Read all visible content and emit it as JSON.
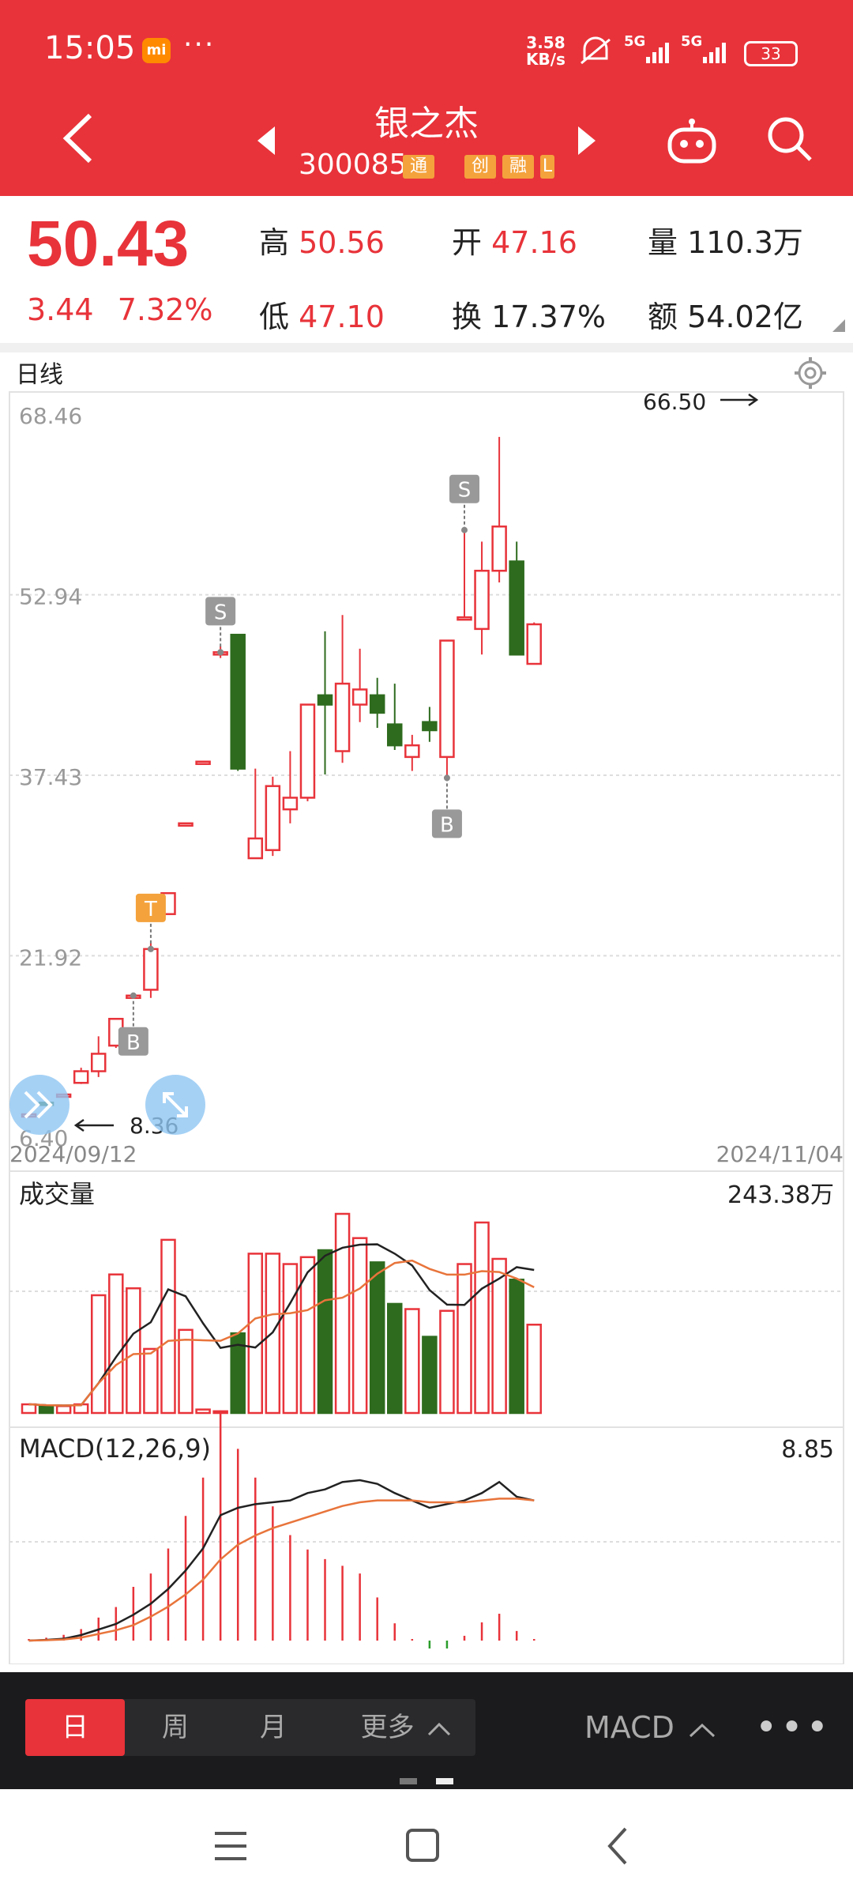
{
  "status_bar": {
    "time": "15:05",
    "mi": "mi",
    "dots": "···",
    "speed_top": "3.58",
    "speed_bottom": "KB/s",
    "sig1": "5G",
    "sig2": "5G",
    "battery": "33"
  },
  "header": {
    "name": "银之杰",
    "code": "300085",
    "tags": [
      "通",
      "创",
      "融",
      "L"
    ]
  },
  "quote": {
    "price": "50.43",
    "change": "3.44",
    "change_pct": "7.32%",
    "high_label": "高",
    "high": "50.56",
    "open_label": "开",
    "open": "47.16",
    "vol_label": "量",
    "vol": "110.3万",
    "low_label": "低",
    "low": "47.10",
    "turn_label": "换",
    "turn": "17.37%",
    "amount_label": "额",
    "amount": "54.02亿"
  },
  "kline_panel": {
    "title": "日线",
    "y_labels": [
      "68.46",
      "52.94",
      "37.43",
      "21.92",
      "6.40"
    ],
    "max_note": "66.50",
    "min_note": "8.36",
    "date_start": "2024/09/12",
    "date_end": "2024/11/04",
    "markers": [
      "S",
      "T",
      "B",
      "S",
      "B"
    ]
  },
  "volume_panel": {
    "title": "成交量",
    "max": "243.38万"
  },
  "macd_panel": {
    "title": "MACD(12,26,9)",
    "value": "8.85"
  },
  "bottom_bar": {
    "day": "日",
    "week": "周",
    "month": "月",
    "more": "更多",
    "indicator": "MACD",
    "dots": "•••"
  },
  "colors": {
    "up": "#e8333a",
    "down": "#2e6b1e",
    "ma1": "#222222",
    "ma2": "#e8743b"
  },
  "chart_data": {
    "type": "candlestick",
    "price_range": [
      6.4,
      68.46
    ],
    "candles": [
      {
        "o": 8.3,
        "c": 8.3,
        "h": 8.36,
        "l": 8.36
      },
      {
        "o": 9.3,
        "c": 9.1,
        "h": 9.4,
        "l": 9.0
      },
      {
        "o": 10.0,
        "c": 10.0,
        "h": 10.0,
        "l": 10.0
      },
      {
        "o": 11.0,
        "c": 12.0,
        "h": 12.3,
        "l": 10.9
      },
      {
        "o": 12.0,
        "c": 13.5,
        "h": 15.0,
        "l": 11.5
      },
      {
        "o": 14.2,
        "c": 16.5,
        "h": 16.5,
        "l": 14.0
      },
      {
        "o": 18.5,
        "c": 18.5,
        "h": 18.5,
        "l": 18.5
      },
      {
        "o": 19.0,
        "c": 22.5,
        "h": 23.0,
        "l": 18.3
      },
      {
        "o": 25.5,
        "c": 27.3,
        "h": 27.3,
        "l": 25.5
      },
      {
        "o": 33.3,
        "c": 33.3,
        "h": 33.3,
        "l": 33.3
      },
      {
        "o": 38.6,
        "c": 38.6,
        "h": 38.6,
        "l": 38.6
      },
      {
        "o": 48.0,
        "c": 48.0,
        "h": 48.5,
        "l": 47.5
      },
      {
        "o": 49.5,
        "c": 38.0,
        "h": 49.5,
        "l": 37.8
      },
      {
        "o": 30.3,
        "c": 32.0,
        "h": 38.0,
        "l": 30.3
      },
      {
        "o": 31.0,
        "c": 36.5,
        "h": 37.3,
        "l": 30.5
      },
      {
        "o": 34.5,
        "c": 35.5,
        "h": 39.5,
        "l": 33.3
      },
      {
        "o": 35.5,
        "c": 43.5,
        "h": 43.5,
        "l": 35.2
      },
      {
        "o": 44.3,
        "c": 43.5,
        "h": 49.8,
        "l": 37.5
      },
      {
        "o": 39.5,
        "c": 45.3,
        "h": 51.2,
        "l": 38.5
      },
      {
        "o": 43.5,
        "c": 44.8,
        "h": 48.3,
        "l": 42.0
      },
      {
        "o": 44.3,
        "c": 42.8,
        "h": 45.8,
        "l": 41.5
      },
      {
        "o": 41.8,
        "c": 40.0,
        "h": 45.3,
        "l": 39.6
      },
      {
        "o": 39.0,
        "c": 40.0,
        "h": 40.9,
        "l": 37.8
      },
      {
        "o": 42.0,
        "c": 41.3,
        "h": 43.3,
        "l": 40.3
      },
      {
        "o": 39.0,
        "c": 49.0,
        "h": 49.0,
        "l": 37.2
      },
      {
        "o": 51.0,
        "c": 51.0,
        "h": 58.5,
        "l": 51.0
      },
      {
        "o": 50.0,
        "c": 55.0,
        "h": 57.5,
        "l": 47.8
      },
      {
        "o": 55.0,
        "c": 58.8,
        "h": 66.5,
        "l": 54.0
      },
      {
        "o": 55.8,
        "c": 47.8,
        "h": 57.5,
        "l": 47.8
      },
      {
        "o": 47.0,
        "c": 50.4,
        "h": 50.56,
        "l": 47.1
      }
    ],
    "volume": [
      5,
      4,
      4,
      5,
      68,
      80,
      72,
      37,
      100,
      48,
      2,
      1,
      46,
      92,
      92,
      86,
      90,
      94,
      115,
      101,
      87,
      63,
      60,
      44,
      59,
      86,
      110,
      89,
      77,
      51
    ],
    "macd_line": [
      0,
      0.2,
      0.5,
      1.5,
      3,
      4.5,
      7,
      10,
      14,
      19,
      25,
      34,
      36,
      37,
      37.5,
      38,
      40,
      41,
      43,
      43.5,
      42.5,
      40,
      38,
      36,
      37,
      38,
      40,
      43,
      39,
      38
    ],
    "macd_signal": [
      0,
      0.1,
      0.3,
      0.8,
      1.8,
      2.8,
      4.2,
      6.5,
      9.2,
      12.5,
      16.5,
      22,
      26,
      28.5,
      30.5,
      32,
      33.5,
      35,
      36.5,
      37.5,
      38,
      38,
      38,
      37.5,
      37.5,
      37.5,
      38,
      38.5,
      38.5,
      38
    ],
    "macd_hist": [
      0.1,
      0.3,
      0.6,
      1.2,
      2.4,
      3.5,
      5.6,
      7,
      9.6,
      13,
      17,
      24,
      20,
      17,
      14,
      11,
      9.5,
      8.5,
      7.8,
      7,
      4.5,
      1.8,
      0,
      -0.5,
      -0.4,
      0.5,
      1.9,
      2.8,
      1,
      0.1
    ]
  }
}
